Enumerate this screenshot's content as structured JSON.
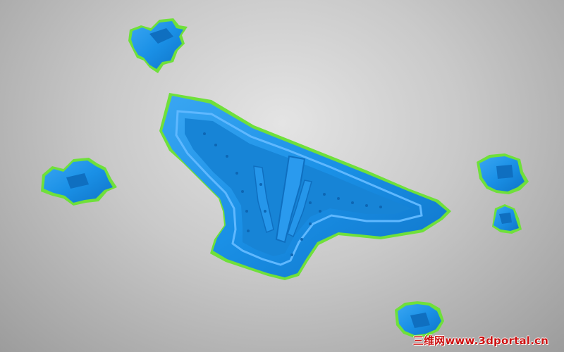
{
  "scene": {
    "mesh_color": "#1a90e6",
    "mesh_shade": "#0f6fc0",
    "mesh_highlight": "#5fb8ff",
    "edge_color": "#6fe03a",
    "background_light": "#e4e4e4",
    "background_dark": "#9c9c9c"
  },
  "watermark": {
    "text": "三维网www.3dportal.cn",
    "color": "#cc1111"
  }
}
